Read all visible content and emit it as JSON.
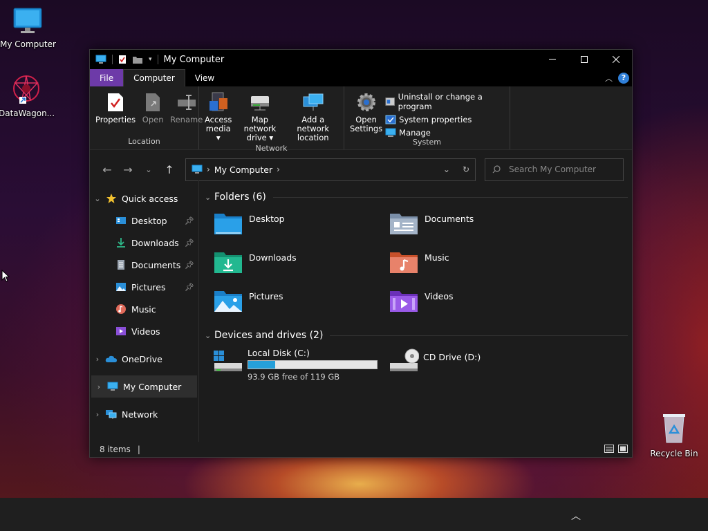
{
  "desktop": {
    "icons": [
      {
        "label": "My Computer",
        "icon": "monitor-icon"
      },
      {
        "label": "DataWagon...",
        "icon": "datawagon-icon"
      },
      {
        "label": "Recycle Bin",
        "icon": "recycle-bin-icon"
      }
    ]
  },
  "window": {
    "title": "My Computer",
    "tabs": {
      "file": "File",
      "computer": "Computer",
      "view": "View"
    },
    "help": "?"
  },
  "ribbon": {
    "location": {
      "name": "Location",
      "properties": "Properties",
      "open": "Open",
      "rename": "Rename"
    },
    "network": {
      "name": "Network",
      "access_media_1": "Access",
      "access_media_2": "media",
      "map_drive_1": "Map network",
      "map_drive_2": "drive",
      "add_location_1": "Add a network",
      "add_location_2": "location"
    },
    "system": {
      "name": "System",
      "open_settings_1": "Open",
      "open_settings_2": "Settings",
      "uninstall": "Uninstall or change a program",
      "system_properties": "System properties",
      "manage": "Manage"
    }
  },
  "address": {
    "crumb": "My Computer",
    "search_placeholder": "Search My Computer"
  },
  "nav": {
    "quick_access": "Quick access",
    "items": [
      {
        "label": "Desktop"
      },
      {
        "label": "Downloads"
      },
      {
        "label": "Documents"
      },
      {
        "label": "Pictures"
      },
      {
        "label": "Music"
      },
      {
        "label": "Videos"
      }
    ],
    "onedrive": "OneDrive",
    "my_computer": "My Computer",
    "network": "Network"
  },
  "content": {
    "folders_header": "Folders (6)",
    "folders": [
      {
        "label": "Desktop"
      },
      {
        "label": "Documents"
      },
      {
        "label": "Downloads"
      },
      {
        "label": "Music"
      },
      {
        "label": "Pictures"
      },
      {
        "label": "Videos"
      }
    ],
    "drives_header": "Devices and drives (2)",
    "drives": [
      {
        "label": "Local Disk (C:)",
        "free": "93.9 GB free of 119 GB",
        "used_fraction": 0.21
      },
      {
        "label": "CD Drive (D:)"
      }
    ]
  },
  "status": {
    "items": "8 items",
    "separator": "|"
  },
  "colors": {
    "accent": "#26a0da",
    "file_tab": "#6d3aa8"
  }
}
